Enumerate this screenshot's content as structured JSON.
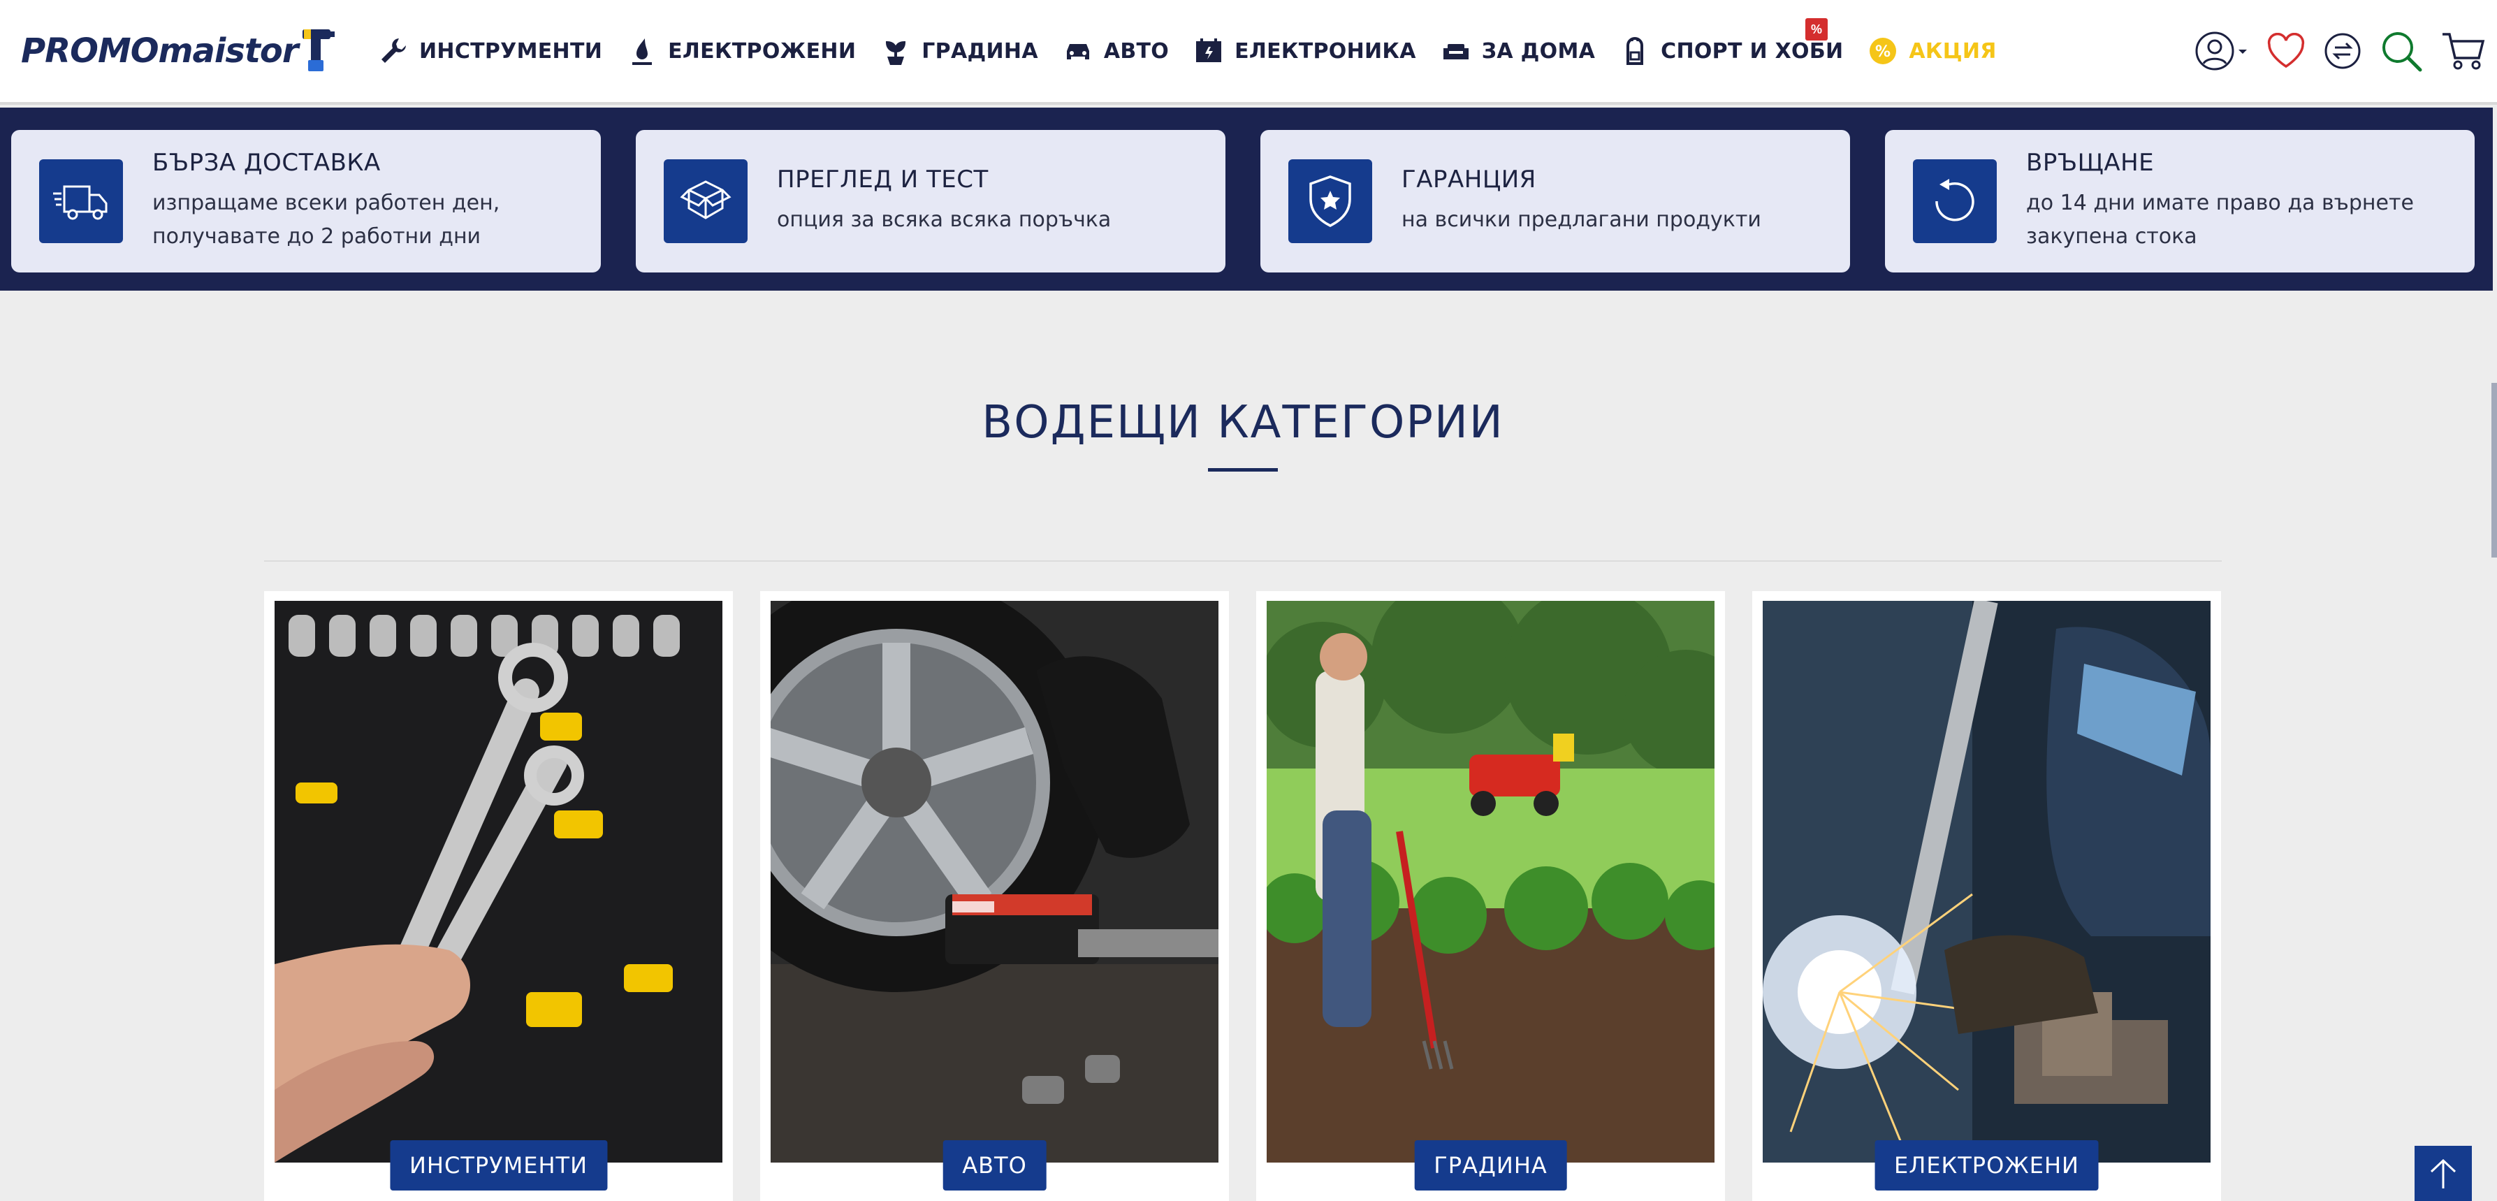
{
  "header": {
    "logo_text": "PROMOmaistor",
    "nav": [
      {
        "label": "ИНСТРУМЕНТИ",
        "icon": "wrench-icon"
      },
      {
        "label": "ЕЛЕКТРОЖЕНИ",
        "icon": "welding-torch-icon"
      },
      {
        "label": "ГРАДИНА",
        "icon": "plant-icon"
      },
      {
        "label": "АВТО",
        "icon": "car-icon"
      },
      {
        "label": "ЕЛЕКТРОНИКА",
        "icon": "electronics-icon"
      },
      {
        "label": "ЗА ДОМА",
        "icon": "sofa-icon"
      },
      {
        "label": "СПОРТ И ХОБИ",
        "icon": "backpack-icon"
      },
      {
        "label": "АКЦИЯ",
        "icon": "discount-icon",
        "badge": "%"
      }
    ],
    "tools": [
      "user-icon",
      "heart-icon",
      "compare-icon",
      "search-icon",
      "cart-icon"
    ]
  },
  "benefits": [
    {
      "title": "БЪРЗА ДОСТАВКА",
      "desc": "изпращаме всеки работен ден, получаваме до 2 работни дни",
      "line1": "изпращаме всеки работен ден,",
      "line2": "получавате до 2 работни дни",
      "icon": "delivery-truck-icon"
    },
    {
      "title": "ПРЕГЛЕД И ТЕСТ",
      "line1": "опция за всяка всяка поръчка",
      "icon": "open-box-icon"
    },
    {
      "title": "ГАРАНЦИЯ",
      "line1": "на всички предлагани продукти",
      "icon": "shield-star-icon"
    },
    {
      "title": "ВРЪЩАНЕ",
      "line1": "до 14 дни имате право да върнете",
      "line2": "закупена стока",
      "icon": "return-arrow-icon"
    }
  ],
  "section": {
    "title": "ВОДЕЩИ КАТЕГОРИИ"
  },
  "categories": [
    {
      "label": "ИНСТРУМЕНТИ"
    },
    {
      "label": "АВТО"
    },
    {
      "label": "ГРАДИНА"
    },
    {
      "label": "ЕЛЕКТРОЖЕНИ"
    }
  ],
  "colors": {
    "brand_navy": "#1b2350",
    "button_blue": "#153b8d",
    "promo_yellow": "#f5c518",
    "badge_red": "#d42e2e"
  }
}
